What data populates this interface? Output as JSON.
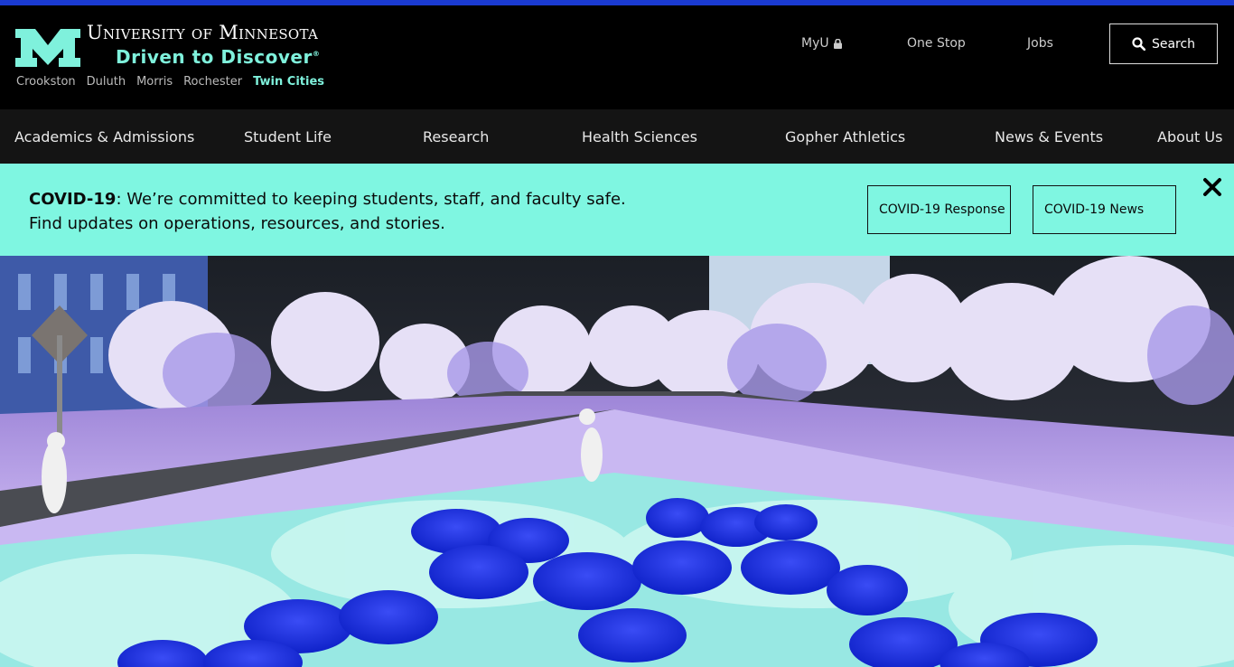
{
  "header": {
    "wordmark": "University of Minnesota",
    "tagline": "Driven to Discover",
    "tagline_mark": "®",
    "campuses": [
      "Crookston",
      "Duluth",
      "Morris",
      "Rochester",
      "Twin Cities"
    ],
    "active_campus": "Twin Cities",
    "utility": {
      "myu": "MyU",
      "one_stop": "One Stop",
      "jobs": "Jobs",
      "search": "Search"
    }
  },
  "nav": {
    "items": [
      "Academics & Admissions",
      "Student Life",
      "Research",
      "Health Sciences",
      "Gopher Athletics",
      "News & Events",
      "About Us"
    ]
  },
  "covid": {
    "label": "COVID-19",
    "line1": ": We’re committed to keeping students, staff, and faculty safe.",
    "line2": "Find updates on operations, resources, and stories.",
    "btn_response": "COVID-19 Response",
    "btn_news": "COVID-19 News"
  },
  "icons": {
    "logo": "block-m-logo",
    "lock": "lock-icon",
    "search": "search-icon",
    "close": "close-icon"
  },
  "colors": {
    "accent_bar": "#1a3ad1",
    "tagline": "#7ff1dc",
    "covid_banner": "#7ff6e1"
  }
}
